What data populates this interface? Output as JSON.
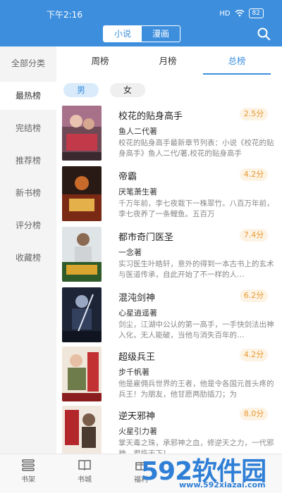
{
  "status_bar": {
    "time": "下午2:16",
    "signal": "HD",
    "battery": "82"
  },
  "header": {
    "segments": [
      "小说",
      "漫画"
    ],
    "active_segment": "小说",
    "search_icon": "search-icon",
    "accent_color": "#3d8fde"
  },
  "sidebar": {
    "items": [
      {
        "label": "全部分类"
      },
      {
        "label": "最热榜"
      },
      {
        "label": "完结榜"
      },
      {
        "label": "推荐榜"
      },
      {
        "label": "新书榜"
      },
      {
        "label": "评分榜"
      },
      {
        "label": "收藏榜"
      }
    ]
  },
  "tabs": {
    "items": [
      "周榜",
      "月榜",
      "总榜"
    ],
    "active": "总榜"
  },
  "gender": {
    "options": [
      "男",
      "女"
    ],
    "active": "男"
  },
  "books": [
    {
      "title": "校花的贴身高手",
      "score": "2.5分",
      "author": "鱼人二代著",
      "desc": "校花的贴身高手最新章节列表：小说《校花的贴身高手》鱼人二代/著,校花的贴身高手"
    },
    {
      "title": "帝霸",
      "score": "4.2分",
      "author": "厌笔萧生著",
      "desc": "千万年前，李七夜栽下一株翠竹。八百万年前，李七夜养了一条鲤鱼。五百万"
    },
    {
      "title": "都市奇门医圣",
      "score": "7.4分",
      "author": "一念著",
      "desc": "实习医生叶皓轩，意外的得到一本古书上的玄术与医道传承，自此开始了不一样的人…"
    },
    {
      "title": "混沌剑神",
      "score": "6.2分",
      "author": "心星逍遥著",
      "desc": "剑尘，江湖中公认的第一高手，一手快剑法出神入化，无人能破，当他与消失百年的…"
    },
    {
      "title": "超级兵王",
      "score": "4.2分",
      "author": "步千帆著",
      "desc": "他是雇佣兵世界的王者，他是令各国元首头疼的兵王！为朋友，他甘愿两肋插刀；为"
    },
    {
      "title": "逆天邪神",
      "score": "8.0分",
      "author": "火星引力著",
      "desc": "掌天毒之珠，承邪神之血，修逆天之力，一代邪神，君临天下！"
    }
  ],
  "bottom_nav": {
    "items": [
      "书架",
      "书城",
      "福利",
      "",
      ""
    ]
  },
  "watermark": {
    "logo": "592软件园",
    "url": "www.592xiazai.com"
  }
}
